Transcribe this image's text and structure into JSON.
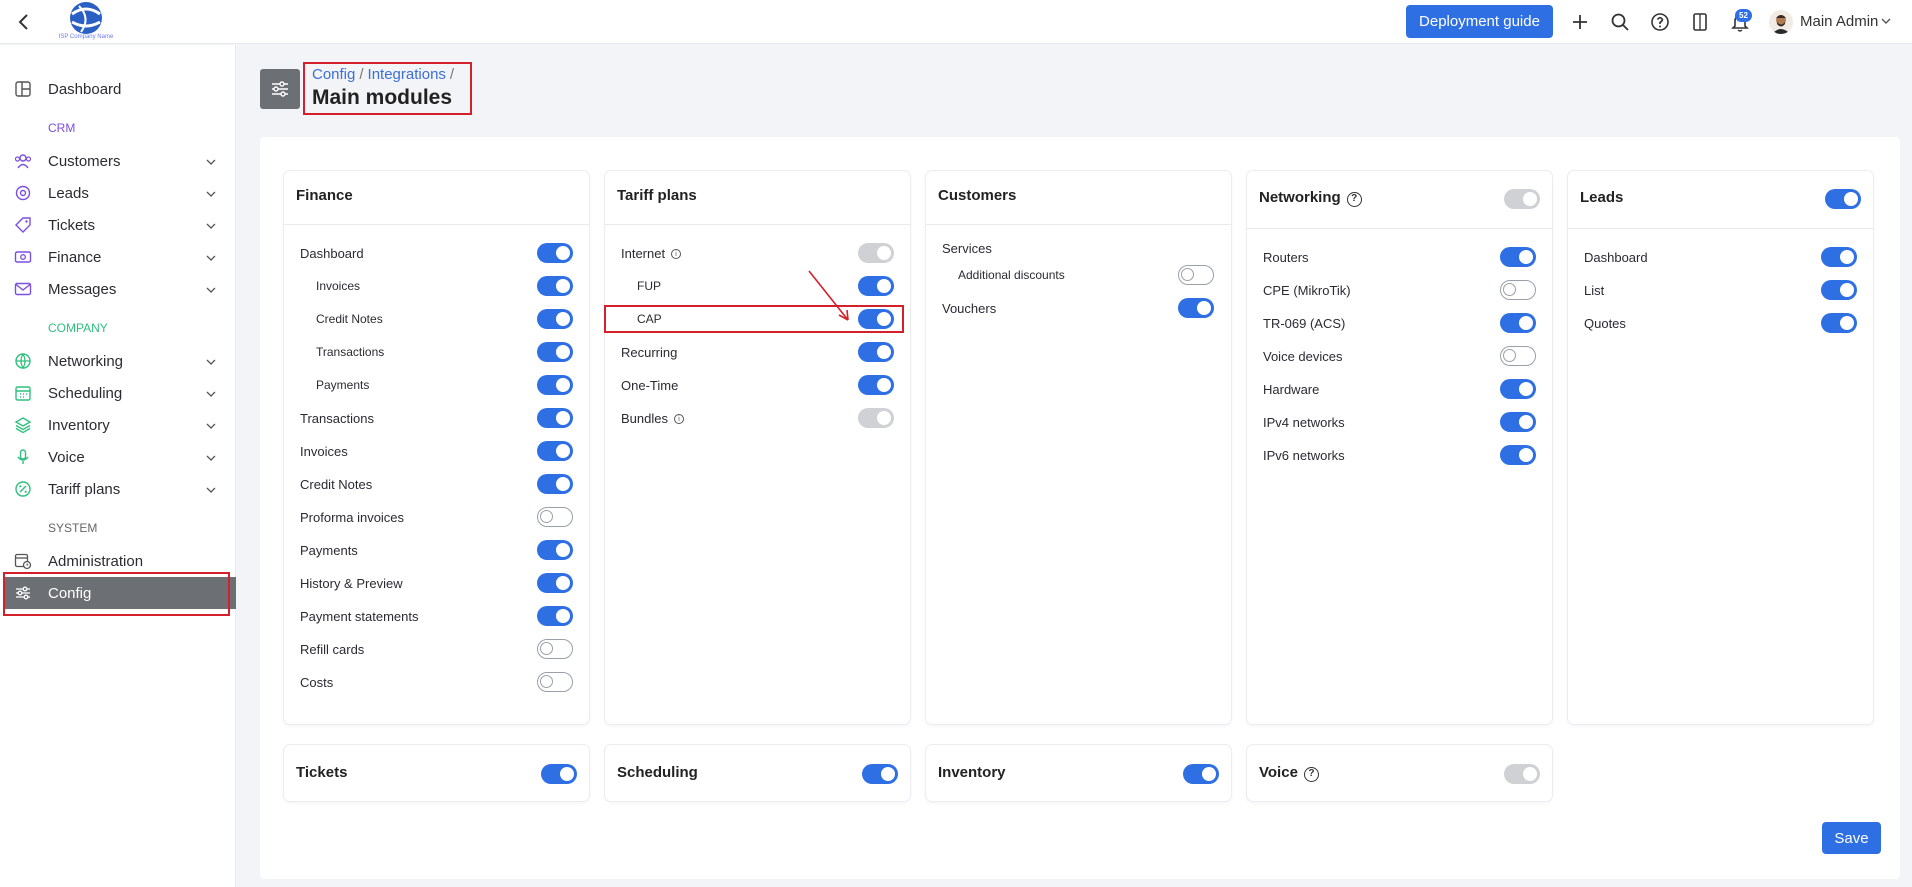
{
  "topbar": {
    "logo_text": "ISP Company Name",
    "deploy_label": "Deployment guide",
    "notif_count": "52",
    "user_name": "Main Admin"
  },
  "sidebar": {
    "sections": {
      "crm": "CRM",
      "company": "COMPANY",
      "system": "SYSTEM"
    },
    "items": {
      "dashboard": "Dashboard",
      "customers": "Customers",
      "leads": "Leads",
      "tickets": "Tickets",
      "finance": "Finance",
      "messages": "Messages",
      "networking": "Networking",
      "scheduling": "Scheduling",
      "inventory": "Inventory",
      "voice": "Voice",
      "tariff_plans": "Tariff plans",
      "administration": "Administration",
      "config": "Config"
    },
    "colors": {
      "crm": "#7b4fe0",
      "company": "#2fbf7e",
      "system": "#666666"
    }
  },
  "header": {
    "crumb1": "Config",
    "crumb2": "Integrations",
    "sep": "/",
    "title": "Main modules"
  },
  "cards": {
    "finance": {
      "title": "Finance",
      "rows": [
        {
          "label": "Dashboard",
          "state": "on"
        },
        {
          "label": "Invoices",
          "state": "on"
        },
        {
          "label": "Credit Notes",
          "state": "on"
        },
        {
          "label": "Transactions",
          "state": "on"
        },
        {
          "label": "Payments",
          "state": "on"
        },
        {
          "label": "Transactions",
          "state": "on"
        },
        {
          "label": "Invoices",
          "state": "on"
        },
        {
          "label": "Credit Notes",
          "state": "on"
        },
        {
          "label": "Proforma invoices",
          "state": "off"
        },
        {
          "label": "Payments",
          "state": "on"
        },
        {
          "label": "History & Preview",
          "state": "on"
        },
        {
          "label": "Payment statements",
          "state": "on"
        },
        {
          "label": "Refill cards",
          "state": "off"
        },
        {
          "label": "Costs",
          "state": "off"
        }
      ]
    },
    "tariff": {
      "title": "Tariff plans",
      "rows": [
        {
          "label": "Internet",
          "state": "disabled"
        },
        {
          "label": "FUP",
          "state": "on"
        },
        {
          "label": "CAP",
          "state": "on"
        },
        {
          "label": "Recurring",
          "state": "on"
        },
        {
          "label": "One-Time",
          "state": "on"
        },
        {
          "label": "Bundles",
          "state": "disabled"
        }
      ]
    },
    "customers": {
      "title": "Customers",
      "rows": [
        {
          "label": "Services",
          "state": "none"
        },
        {
          "label": "Additional discounts",
          "state": "off"
        },
        {
          "label": "Vouchers",
          "state": "on"
        }
      ]
    },
    "networking": {
      "title": "Networking",
      "header_state": "disabled",
      "rows": [
        {
          "label": "Routers",
          "state": "on"
        },
        {
          "label": "CPE (MikroTik)",
          "state": "off"
        },
        {
          "label": "TR-069 (ACS)",
          "state": "on"
        },
        {
          "label": "Voice devices",
          "state": "off"
        },
        {
          "label": "Hardware",
          "state": "on"
        },
        {
          "label": "IPv4 networks",
          "state": "on"
        },
        {
          "label": "IPv6 networks",
          "state": "on"
        }
      ]
    },
    "leads": {
      "title": "Leads",
      "header_state": "on",
      "rows": [
        {
          "label": "Dashboard",
          "state": "on"
        },
        {
          "label": "List",
          "state": "on"
        },
        {
          "label": "Quotes",
          "state": "on"
        }
      ]
    },
    "tickets": {
      "title": "Tickets",
      "header_state": "on"
    },
    "scheduling": {
      "title": "Scheduling",
      "header_state": "on"
    },
    "inventory": {
      "title": "Inventory",
      "header_state": "on"
    },
    "voice": {
      "title": "Voice",
      "header_state": "disabled"
    }
  },
  "save_label": "Save",
  "colors": {
    "accent": "#2f6fe4",
    "active_nav": "#6c7075",
    "highlight": "#d4202b"
  },
  "icons": {
    "back": "chevron-left-icon",
    "plus": "plus-icon",
    "search": "search-icon",
    "help": "question-circle-icon",
    "book": "book-icon",
    "bell": "bell-icon"
  }
}
